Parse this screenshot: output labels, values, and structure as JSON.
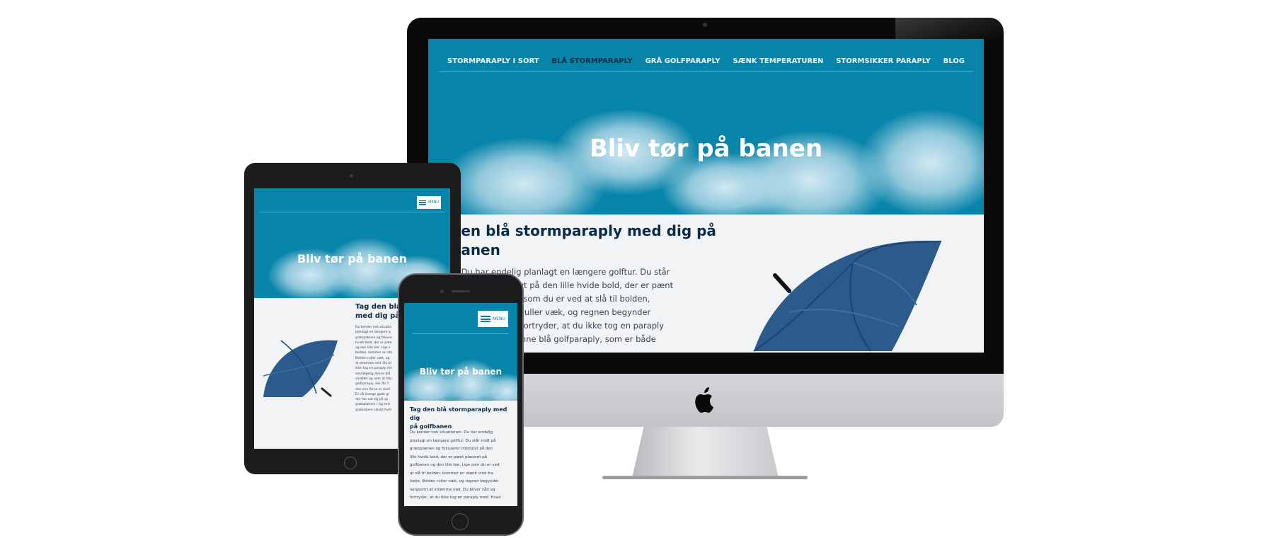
{
  "site": {
    "nav": [
      "STORMPARAPLY I SORT",
      "BLÅ STORMPARAPLY",
      "GRÅ GOLFPARAPLY",
      "SÆNK TEMPERATUREN",
      "STORMSIKKER PARAPLY",
      "BLOG"
    ],
    "active_nav_index": 1,
    "hero_title": "Bliv tør på banen",
    "menu_label": "MENU",
    "colors": {
      "hero": "#0784a9",
      "heading": "#0b2a45",
      "content_bg": "#f2f3f5",
      "nav_active": "#0b3049"
    }
  },
  "desktop": {
    "heading_lines": [
      "den blå stormparaply med dig på",
      "banen"
    ],
    "body_lines": [
      "n. Du har endelig planlagt en længere golftur. Du står",
      "fokuserer intensivt på den lille hvide bold, der er pænt",
      "den lille tee. Lige som du er ved at slå til bolden,",
      "fra højre. Bolden ruller væk, og regnen begynder",
      "Du bliver våd og fortryder, at du ikke tog en paraply",
      "er selvfølgelig denne blå golfparaply, som er både"
    ]
  },
  "tablet": {
    "heading_lines": [
      "Tag den blå",
      "med dig på go"
    ],
    "body_lines": [
      "Du kender nok situatio",
      "planlagt en længere g",
      "græsplænen og fokuse",
      "hvide bold, der er pæn",
      "og den lille tee. Lige s",
      "bolden, kommer en sta",
      "Bolden ruller væk, og",
      "at strømme ned. Du bl",
      "ikke tog en paraply me",
      "selvfølgelig denne blå",
      "vindtæt og nem at hån",
      "golfparaply, der får 5",
      "den ene farve er mod",
      "Én så mange gode gr",
      "der har sat sig på sp",
      "græsplænen i sig selv",
      "græssikere slankt hvid"
    ]
  },
  "phone": {
    "heading_lines": [
      "Tag den blå stormparaply med dig",
      "på golfbanen"
    ],
    "body_lines": [
      "Du kender nok situationen. Du har endelig",
      "planlagt en længere golftur. Du står midt på",
      "græsplænen og fokuserer intensivt på den",
      "lille hvide bold, der er pænt placeret på",
      "golfbanen og den lille tee. Lige som du er ved",
      "at slå til bolden, kommer en stærk vind fra",
      "højre. Bolden ruller væk, og regnen begynder",
      "langsomt at strømme ned. Du bliver våd og",
      "fortryder, at du ikke tog en paraply med. Hvad"
    ]
  },
  "icons": {
    "camera": "camera-icon",
    "apple_logo": "apple-logo-icon",
    "home_button": "home-button-icon",
    "hamburger": "hamburger-icon",
    "umbrella": "umbrella-image"
  }
}
